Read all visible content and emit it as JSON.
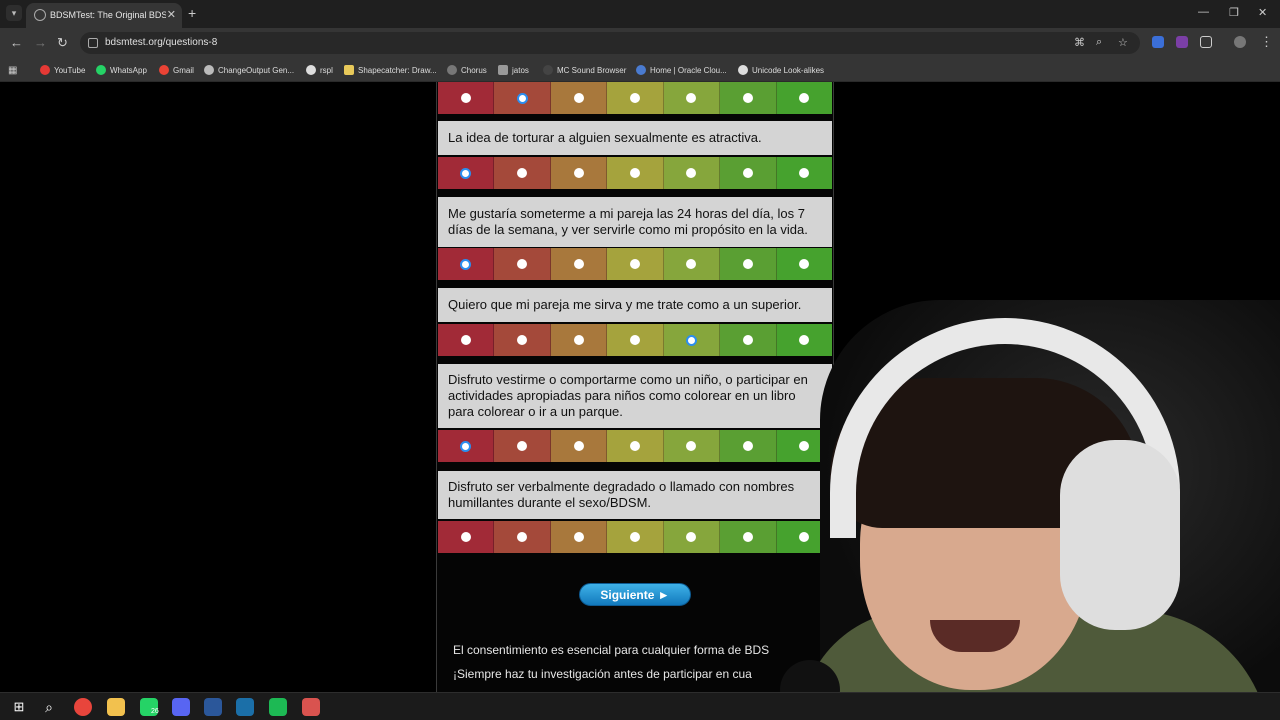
{
  "browser": {
    "tab_title": "BDSMTest: The Original BDSM /",
    "url": "bdsmtest.org/questions-8",
    "bookmarks": [
      {
        "label": "YouTube",
        "color": "#e53935"
      },
      {
        "label": "WhatsApp",
        "color": "#25d366"
      },
      {
        "label": "Gmail",
        "color": "#ea4335"
      },
      {
        "label": "ChangeOutput Gen...",
        "color": "#bbbbbb"
      },
      {
        "label": "rspl",
        "color": "#dddddd"
      },
      {
        "label": "Shapecatcher: Draw...",
        "color": "#e8c95a"
      },
      {
        "label": "Chorus",
        "color": "#777777"
      },
      {
        "label": "jatos",
        "color": "#999999"
      },
      {
        "label": "MC Sound Browser",
        "color": "#444444"
      },
      {
        "label": "Home | Oracle Clou...",
        "color": "#4a7bd0"
      },
      {
        "label": "Unicode Look-alikes",
        "color": "#dddddd"
      }
    ]
  },
  "colors": {
    "scale": [
      "#a12a37",
      "#a4493a",
      "#a8783c",
      "#a5a33d",
      "#86a63c",
      "#5a9f33",
      "#46a22e"
    ],
    "selected_ring": "#2b8ef0"
  },
  "questions": [
    {
      "text": "",
      "selected": 1
    },
    {
      "text": "La idea de torturar a alguien sexualmente es atractiva.",
      "selected": 0
    },
    {
      "text": "Me gustaría someterme a mi pareja las 24 horas del día, los 7 días de la semana, y ver servirle como mi propósito en la vida.",
      "selected": 0
    },
    {
      "text": "Quiero que mi pareja me sirva y me trate como a un superior.",
      "selected": 4
    },
    {
      "text": "Disfruto vestirme o comportarme como un niño, o participar en actividades apropiadas para niños como colorear en un libro para colorear o ir a un parque.",
      "selected": 0
    },
    {
      "text": "Disfruto ser verbalmente degradado o llamado con nombres humillantes durante el sexo/BDSM.",
      "selected": -1
    }
  ],
  "next_button": "Siguiente ►",
  "footer": {
    "line1": "El consentimiento es esencial para cualquier forma de BDS",
    "line2": "¡Siempre haz tu investigación antes de participar en cua"
  },
  "taskbar": {
    "whatsapp_badge": "26",
    "apps": [
      {
        "name": "chrome-icon",
        "color": "#e8453c"
      },
      {
        "name": "file-explorer-icon",
        "color": "#f2c14e"
      },
      {
        "name": "whatsapp-icon",
        "color": "#25d366"
      },
      {
        "name": "discord-icon",
        "color": "#5865f2"
      },
      {
        "name": "word-icon",
        "color": "#2b579a"
      },
      {
        "name": "steam-icon",
        "color": "#1b6fa8"
      },
      {
        "name": "spotify-icon",
        "color": "#1db954"
      },
      {
        "name": "app-icon",
        "color": "#d9534f"
      }
    ]
  }
}
